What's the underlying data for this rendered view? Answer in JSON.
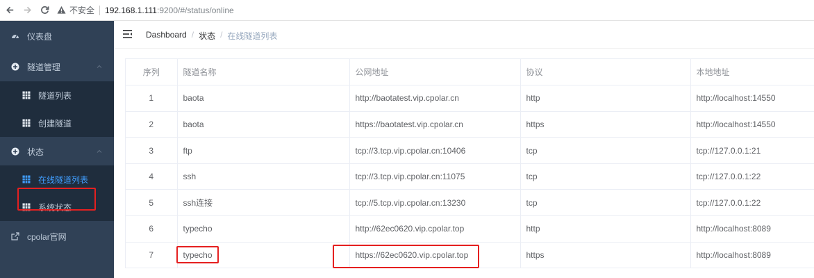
{
  "browser": {
    "insecure_label": "不安全",
    "url_host": "192.168.1.111",
    "url_rest": ":9200/#/status/online"
  },
  "sidebar": {
    "items": [
      {
        "label": "仪表盘",
        "icon": "dashboard-icon"
      },
      {
        "label": "隧道管理",
        "icon": "plus-circle-icon"
      },
      {
        "label": "隧道列表",
        "icon": "grid-icon"
      },
      {
        "label": "创建隧道",
        "icon": "grid-icon"
      },
      {
        "label": "状态",
        "icon": "plus-circle-icon"
      },
      {
        "label": "在线隧道列表",
        "icon": "grid-icon"
      },
      {
        "label": "系统状态",
        "icon": "grid-icon"
      },
      {
        "label": "cpolar官网",
        "icon": "external-link-icon"
      }
    ]
  },
  "breadcrumb": [
    "Dashboard",
    "状态",
    "在线隧道列表"
  ],
  "table": {
    "headers": [
      "序列",
      "隧道名称",
      "公网地址",
      "协议",
      "本地地址"
    ],
    "rows": [
      [
        "1",
        "baota",
        "http://baotatest.vip.cpolar.cn",
        "http",
        "http://localhost:14550"
      ],
      [
        "2",
        "baota",
        "https://baotatest.vip.cpolar.cn",
        "https",
        "http://localhost:14550"
      ],
      [
        "3",
        "ftp",
        "tcp://3.tcp.vip.cpolar.cn:10406",
        "tcp",
        "tcp://127.0.0.1:21"
      ],
      [
        "4",
        "ssh",
        "tcp://3.tcp.vip.cpolar.cn:11075",
        "tcp",
        "tcp://127.0.0.1:22"
      ],
      [
        "5",
        "ssh连接",
        "tcp://5.tcp.vip.cpolar.cn:13230",
        "tcp",
        "tcp://127.0.0.1:22"
      ],
      [
        "6",
        "typecho",
        "http://62ec0620.vip.cpolar.top",
        "http",
        "http://localhost:8089"
      ],
      [
        "7",
        "typecho",
        "https://62ec0620.vip.cpolar.top",
        "https",
        "http://localhost:8089"
      ]
    ]
  },
  "colors": {
    "sidebar_bg": "#304156",
    "submenu_bg": "#1f2d3d",
    "active": "#409eff",
    "annotation": "#e52020"
  }
}
